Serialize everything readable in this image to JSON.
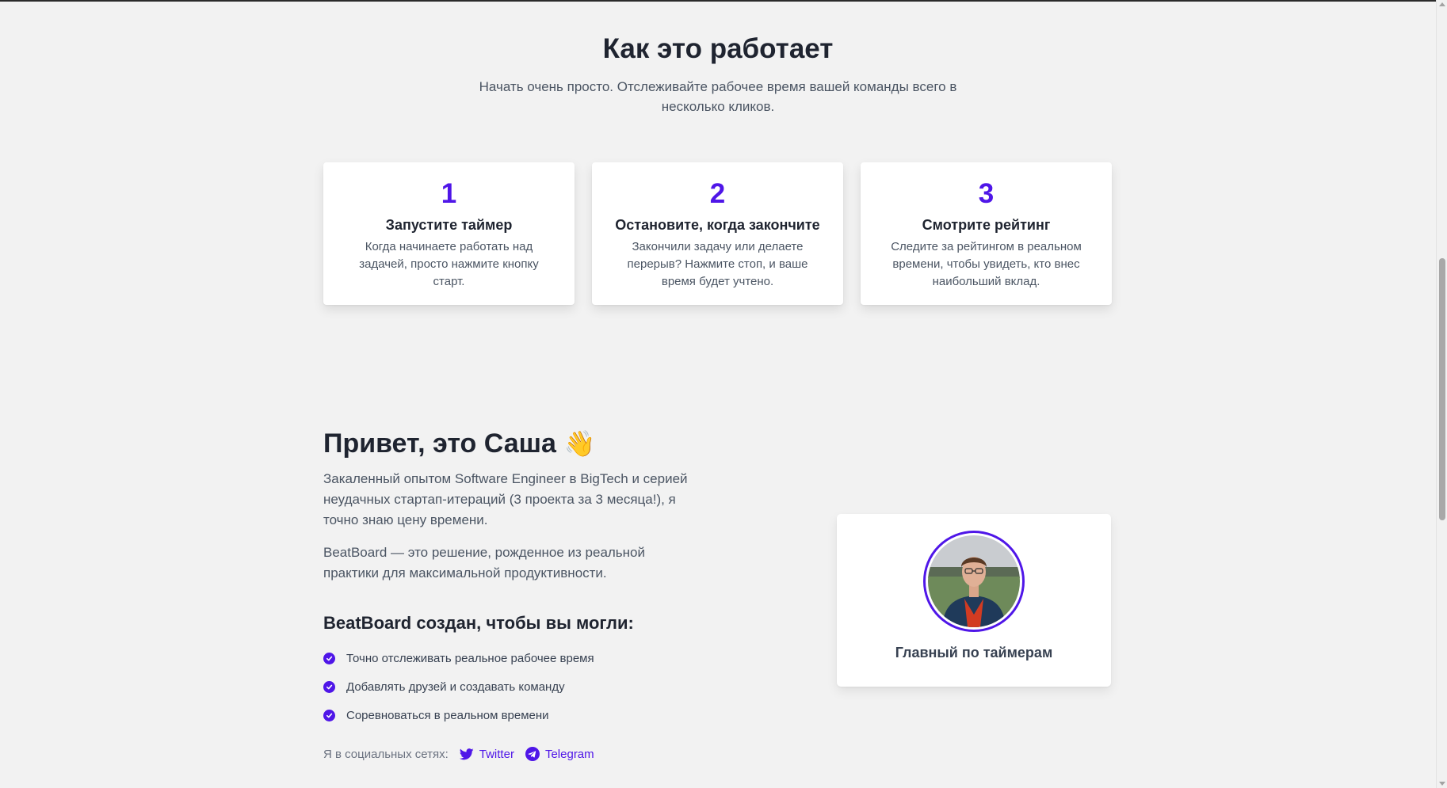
{
  "how": {
    "title": "Как это работает",
    "subtitle": "Начать очень просто. Отслеживайте рабочее время вашей команды всего в несколько кликов.",
    "steps": [
      {
        "num": "1",
        "title": "Запустите таймер",
        "text": "Когда начинаете работать над задачей, просто нажмите кнопку старт."
      },
      {
        "num": "2",
        "title": "Остановите, когда закончите",
        "text": "Закончили задачу или делаете перерыв? Нажмите стоп, и ваше время будет учтено."
      },
      {
        "num": "3",
        "title": "Смотрите рейтинг",
        "text": "Следите за рейтингом в реальном времени, чтобы увидеть, кто внес наибольший вклад."
      }
    ]
  },
  "about": {
    "title": "Привет, это Саша",
    "wave_emoji": "👋",
    "paragraph1": "Закаленный опытом Software Engineer в BigTech и серией неудачных стартап-итераций (3 проекта за 3 месяца!), я точно знаю цену времени.",
    "paragraph2": "BeatBoard — это решение, рожденное из реальной практики для максимальной продуктивности.",
    "can_title": "BeatBoard создан, чтобы вы могли:",
    "can_items": [
      "Точно отслеживать реальное рабочее время",
      "Добавлять друзей и создавать команду",
      "Соревноваться в реальном времени"
    ],
    "social_label": "Я в социальных сетях:",
    "twitter_label": "Twitter",
    "telegram_label": "Telegram"
  },
  "profile": {
    "caption": "Главный по таймерам"
  },
  "colors": {
    "accent": "#4f16e8",
    "background": "#f2f2f2",
    "card": "#ffffff"
  }
}
